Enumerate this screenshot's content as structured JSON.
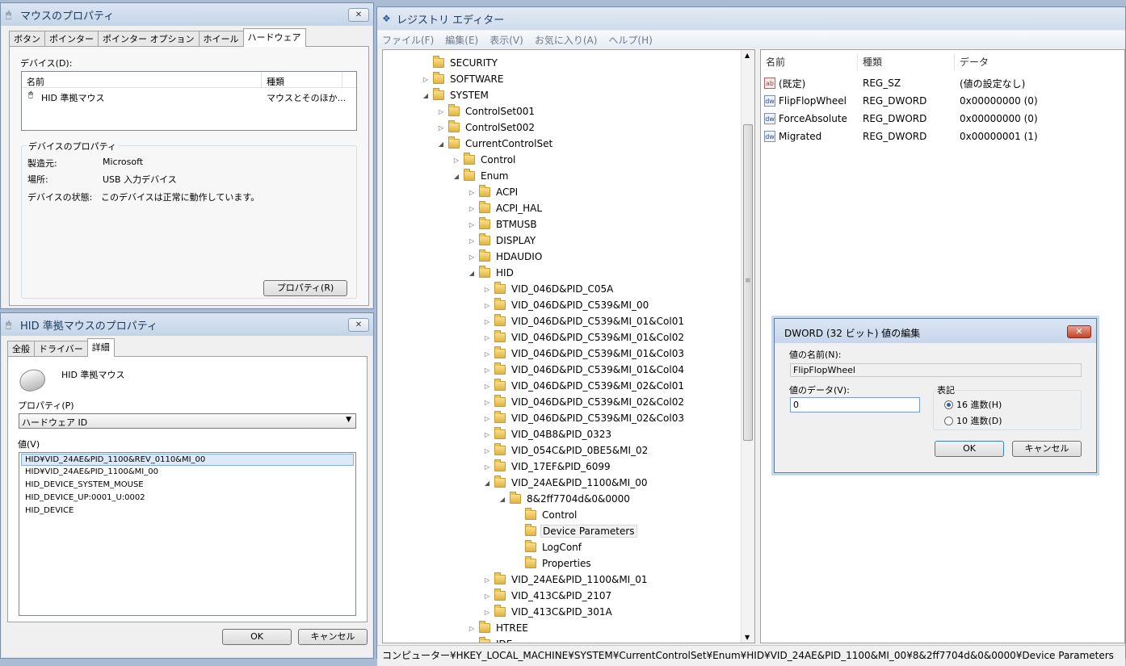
{
  "mouse_props": {
    "title": "マウスのプロパティ",
    "tabs": [
      "ボタン",
      "ポインター",
      "ポインター オプション",
      "ホイール",
      "ハードウェア"
    ],
    "devices_label": "デバイス(D):",
    "col_name": "名前",
    "col_type": "種類",
    "device_name": "HID 準拠マウス",
    "device_type": "マウスとそのほか...",
    "group_title": "デバイスのプロパティ",
    "manufacturer_label": "製造元:",
    "manufacturer_value": "Microsoft",
    "location_label": "場所:",
    "location_value": "USB 入力デバイス",
    "status_label": "デバイスの状態:",
    "status_value": "このデバイスは正常に動作しています。",
    "properties_button": "プロパティ(R)"
  },
  "hid_props": {
    "title": "HID 準拠マウスのプロパティ",
    "tabs": [
      "全般",
      "ドライバー",
      "詳細"
    ],
    "device_name": "HID 準拠マウス",
    "property_label": "プロパティ(P)",
    "property_value": "ハードウェア ID",
    "value_label": "値(V)",
    "values": [
      "HID¥VID_24AE&PID_1100&REV_0110&MI_00",
      "HID¥VID_24AE&PID_1100&MI_00",
      "HID_DEVICE_SYSTEM_MOUSE",
      "HID_DEVICE_UP:0001_U:0002",
      "HID_DEVICE"
    ],
    "ok": "OK",
    "cancel": "キャンセル"
  },
  "regedit": {
    "title": "レジストリ エディター",
    "menu": [
      "ファイル(F)",
      "編集(E)",
      "表示(V)",
      "お気に入り(A)",
      "ヘルプ(H)"
    ],
    "tree": [
      {
        "label": "SECURITY",
        "depth": 0,
        "exp": ""
      },
      {
        "label": "SOFTWARE",
        "depth": 0,
        "exp": "▷"
      },
      {
        "label": "SYSTEM",
        "depth": 0,
        "exp": "◢"
      },
      {
        "label": "ControlSet001",
        "depth": 1,
        "exp": "▷"
      },
      {
        "label": "ControlSet002",
        "depth": 1,
        "exp": "▷"
      },
      {
        "label": "CurrentControlSet",
        "depth": 1,
        "exp": "◢"
      },
      {
        "label": "Control",
        "depth": 2,
        "exp": "▷"
      },
      {
        "label": "Enum",
        "depth": 2,
        "exp": "◢"
      },
      {
        "label": "ACPI",
        "depth": 3,
        "exp": "▷"
      },
      {
        "label": "ACPI_HAL",
        "depth": 3,
        "exp": "▷"
      },
      {
        "label": "BTMUSB",
        "depth": 3,
        "exp": "▷"
      },
      {
        "label": "DISPLAY",
        "depth": 3,
        "exp": "▷"
      },
      {
        "label": "HDAUDIO",
        "depth": 3,
        "exp": "▷"
      },
      {
        "label": "HID",
        "depth": 3,
        "exp": "◢"
      },
      {
        "label": "VID_046D&PID_C05A",
        "depth": 4,
        "exp": "▷"
      },
      {
        "label": "VID_046D&PID_C539&MI_00",
        "depth": 4,
        "exp": "▷"
      },
      {
        "label": "VID_046D&PID_C539&MI_01&Col01",
        "depth": 4,
        "exp": "▷"
      },
      {
        "label": "VID_046D&PID_C539&MI_01&Col02",
        "depth": 4,
        "exp": "▷"
      },
      {
        "label": "VID_046D&PID_C539&MI_01&Col03",
        "depth": 4,
        "exp": "▷"
      },
      {
        "label": "VID_046D&PID_C539&MI_01&Col04",
        "depth": 4,
        "exp": "▷"
      },
      {
        "label": "VID_046D&PID_C539&MI_02&Col01",
        "depth": 4,
        "exp": "▷"
      },
      {
        "label": "VID_046D&PID_C539&MI_02&Col02",
        "depth": 4,
        "exp": "▷"
      },
      {
        "label": "VID_046D&PID_C539&MI_02&Col03",
        "depth": 4,
        "exp": "▷"
      },
      {
        "label": "VID_04B8&PID_0323",
        "depth": 4,
        "exp": "▷"
      },
      {
        "label": "VID_054C&PID_0BE5&MI_02",
        "depth": 4,
        "exp": "▷"
      },
      {
        "label": "VID_17EF&PID_6099",
        "depth": 4,
        "exp": "▷"
      },
      {
        "label": "VID_24AE&PID_1100&MI_00",
        "depth": 4,
        "exp": "◢"
      },
      {
        "label": "8&2ff7704d&0&0000",
        "depth": 5,
        "exp": "◢"
      },
      {
        "label": "Control",
        "depth": 6,
        "exp": ""
      },
      {
        "label": "Device Parameters",
        "depth": 6,
        "exp": "",
        "selected": true
      },
      {
        "label": "LogConf",
        "depth": 6,
        "exp": ""
      },
      {
        "label": "Properties",
        "depth": 6,
        "exp": ""
      },
      {
        "label": "VID_24AE&PID_1100&MI_01",
        "depth": 4,
        "exp": "▷"
      },
      {
        "label": "VID_413C&PID_2107",
        "depth": 4,
        "exp": "▷"
      },
      {
        "label": "VID_413C&PID_301A",
        "depth": 4,
        "exp": "▷"
      },
      {
        "label": "HTREE",
        "depth": 3,
        "exp": "▷"
      },
      {
        "label": "IDE",
        "depth": 3,
        "exp": "▷"
      }
    ],
    "columns": [
      "名前",
      "種類",
      "データ"
    ],
    "values": [
      {
        "name": "(既定)",
        "type": "REG_SZ",
        "data": "(値の設定なし)",
        "icon": "ab"
      },
      {
        "name": "FlipFlopWheel",
        "type": "REG_DWORD",
        "data": "0x00000000 (0)",
        "icon": "dw"
      },
      {
        "name": "ForceAbsolute",
        "type": "REG_DWORD",
        "data": "0x00000000 (0)",
        "icon": "dw"
      },
      {
        "name": "Migrated",
        "type": "REG_DWORD",
        "data": "0x00000001 (1)",
        "icon": "dw"
      }
    ],
    "status_path": "コンピューター¥HKEY_LOCAL_MACHINE¥SYSTEM¥CurrentControlSet¥Enum¥HID¥VID_24AE&PID_1100&MI_00¥8&2ff7704d&0&0000¥Device Parameters"
  },
  "dword_dialog": {
    "title": "DWORD (32 ビット) 値の編集",
    "name_label": "値の名前(N):",
    "name_value": "FlipFlopWheel",
    "data_label": "値のデータ(V):",
    "data_value": "0",
    "base_label": "表記",
    "hex_label": "16 進数(H)",
    "dec_label": "10 進数(D)",
    "ok": "OK",
    "cancel": "キャンセル"
  }
}
